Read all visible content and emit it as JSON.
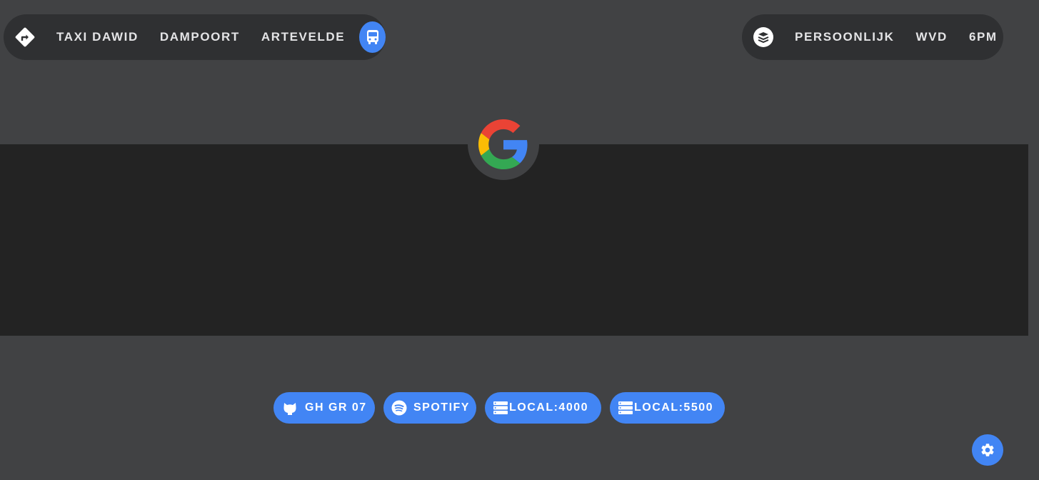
{
  "left_nav": {
    "icon": "directions-icon",
    "links": [
      "TAXI DAWID",
      "DAMPOORT",
      "ARTEVELDE"
    ],
    "bus_button_icon": "bus-icon"
  },
  "right_nav": {
    "icon": "layers-icon",
    "links": [
      "PERSOONLIJK",
      "WVD",
      "6PM"
    ]
  },
  "search": {
    "logo": "google-logo-icon"
  },
  "shortcuts": [
    {
      "label": "GH GR 07",
      "icon": "github-icon"
    },
    {
      "label": "SPOTIFY",
      "icon": "spotify-icon"
    },
    {
      "label": "LOCAL:4000",
      "icon": "server-icon"
    },
    {
      "label": "LOCAL:5500",
      "icon": "server-icon"
    }
  ],
  "settings": {
    "icon": "gear-icon"
  },
  "colors": {
    "background": "#414244",
    "band": "#232323",
    "pill": "#2f3032",
    "accent": "#4285f4",
    "nav_text": "#e4e4e6"
  }
}
